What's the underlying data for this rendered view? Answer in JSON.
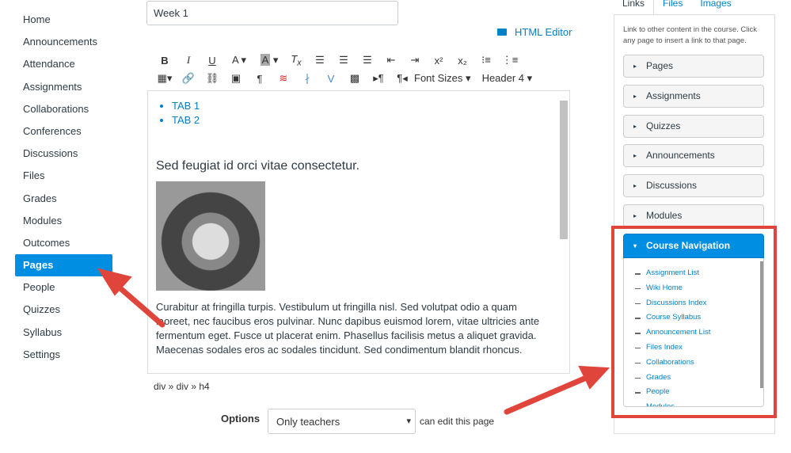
{
  "sidebar": {
    "items": [
      "Home",
      "Announcements",
      "Attendance",
      "Assignments",
      "Collaborations",
      "Conferences",
      "Discussions",
      "Files",
      "Grades",
      "Modules",
      "Outcomes",
      "Pages",
      "People",
      "Quizzes",
      "Syllabus",
      "Settings"
    ],
    "active": "Pages"
  },
  "editor": {
    "title_value": "Week 1",
    "html_editor_label": "HTML Editor",
    "font_sizes_label": "Font Sizes",
    "format_label": "Header 4",
    "list_items": [
      "TAB 1",
      "TAB 2"
    ],
    "heading": "Sed feugiat id orci vitae consectetur.",
    "paragraph": "Curabitur at fringilla turpis. Vestibulum ut fringilla nisl. Sed volutpat odio a quam laoreet, nec faucibus eros pulvinar. Nunc dapibus euismod lorem, vitae ultricies ante fermentum eget. Fusce ut placerat enim. Phasellus facilisis metus a aliquet gravida. Maecenas sodales eros ac sodales tincidunt. Sed condimentum blandit rhoncus.",
    "path": "div » div » h4"
  },
  "options": {
    "label": "Options",
    "select_value": "Only teachers",
    "suffix": "can edit this page"
  },
  "right_panel": {
    "tabs": [
      "Links",
      "Files",
      "Images"
    ],
    "active_tab": "Links",
    "description": "Link to other content in the course. Click any page to insert a link to that page.",
    "sections": [
      "Pages",
      "Assignments",
      "Quizzes",
      "Announcements",
      "Discussions",
      "Modules"
    ],
    "open_section": "Course Navigation",
    "nav_links": [
      "Assignment List",
      "Wiki Home",
      "Discussions Index",
      "Course Syllabus",
      "Announcement List",
      "Files Index",
      "Collaborations",
      "Grades",
      "People",
      "Modules"
    ]
  },
  "colors": {
    "accent": "#008ee2",
    "link": "#0081c9",
    "annotation": "#e0453c"
  }
}
